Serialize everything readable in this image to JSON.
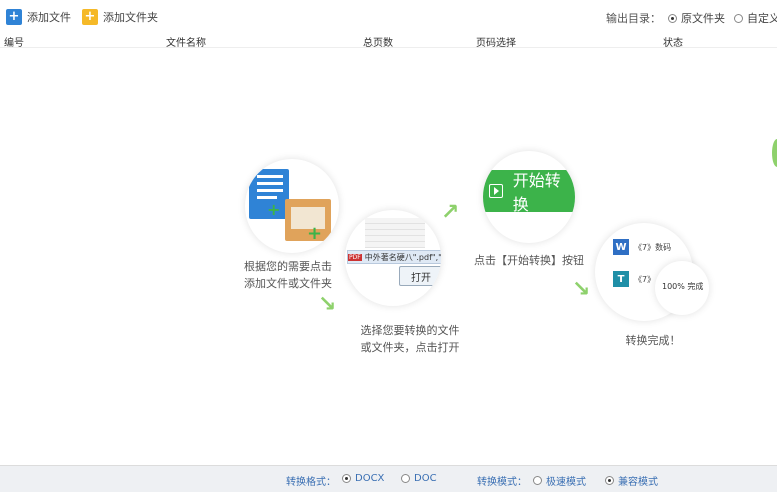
{
  "toolbar": {
    "add_file": "添加文件",
    "add_folder": "添加文件夹",
    "output_label": "输出目录：",
    "output_options": [
      "原文件夹",
      "自定义"
    ],
    "output_selected": "原文件夹"
  },
  "table": {
    "columns": [
      "编号",
      "文件名称",
      "总页数",
      "页码选择",
      "状态"
    ]
  },
  "steps": {
    "step1": "根据您的需要点击添加文件或文件夹",
    "step1_line1": "根据您的需要点击",
    "step1_line2": "添加文件或文件夹",
    "step2_line1": "选择您要转换的文件",
    "step2_line2": "或文件夹，点击打开",
    "step2_dialog_filename": "中外著名硬八\".pdf\",\"",
    "step2_dialog_open": "打开",
    "step3_text": "点击【开始转换】按钮",
    "step3_button": "开始转换",
    "step4_text": "转换完成！",
    "step4_item1": "《7》数码",
    "step4_item2": "《7》",
    "step4_progress": "100%",
    "step4_status": "完成"
  },
  "footer": {
    "format_label": "转换格式：",
    "format_options": [
      "DOCX",
      "DOC"
    ],
    "format_selected": "DOCX",
    "mode_label": "转换模式：",
    "mode_options": [
      "极速模式",
      "兼容模式"
    ],
    "mode_selected": "兼容模式"
  },
  "colors": {
    "accent_green": "#3cb34a",
    "arrow_green": "#8ed16c",
    "footer_text_blue": "#3a6fb3",
    "icon_blue": "#2f83d6",
    "icon_yellow": "#f5b928"
  }
}
